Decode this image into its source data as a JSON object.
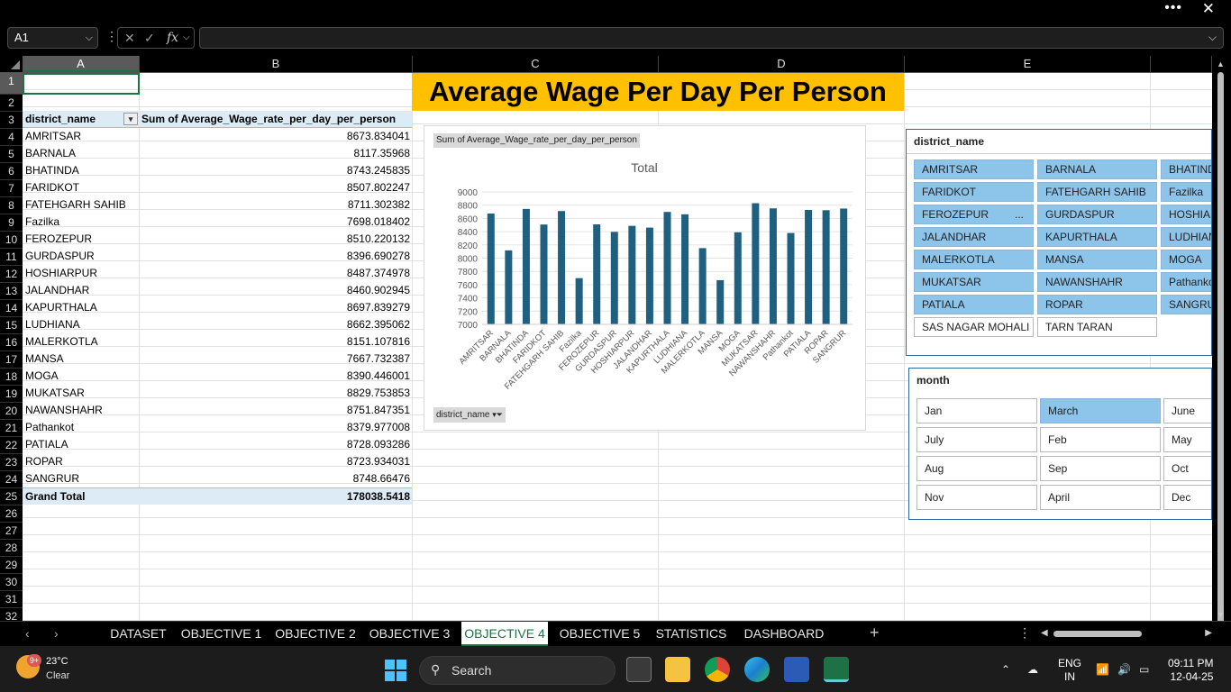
{
  "window": {
    "more_label": "•••",
    "close_label": "✕"
  },
  "formula_bar": {
    "name_box": "A1",
    "cancel_icon": "✕",
    "enter_icon": "✓",
    "fx_label": "fx",
    "formula_value": ""
  },
  "columns": [
    "A",
    "B",
    "C",
    "D",
    "E"
  ],
  "rows": [
    "1",
    "2",
    "3",
    "4",
    "5",
    "6",
    "7",
    "8",
    "9",
    "10",
    "11",
    "12",
    "13",
    "14",
    "15",
    "16",
    "17",
    "18",
    "19",
    "20",
    "21",
    "22",
    "23",
    "24",
    "25",
    "26",
    "27",
    "28",
    "29",
    "30",
    "31",
    "32"
  ],
  "banner_title": "Average Wage Per Day Per Person",
  "pivot": {
    "header_district": "district_name",
    "header_value": "Sum of Average_Wage_rate_per_day_per_person",
    "rows": [
      {
        "name": "AMRITSAR",
        "value": "8673.834041"
      },
      {
        "name": "BARNALA",
        "value": "8117.35968"
      },
      {
        "name": "BHATINDA",
        "value": "8743.245835"
      },
      {
        "name": "FARIDKOT",
        "value": "8507.802247"
      },
      {
        "name": "FATEHGARH SAHIB",
        "value": "8711.302382"
      },
      {
        "name": "Fazilka",
        "value": "7698.018402"
      },
      {
        "name": "FEROZEPUR",
        "value": "8510.220132"
      },
      {
        "name": "GURDASPUR",
        "value": "8396.690278"
      },
      {
        "name": "HOSHIARPUR",
        "value": "8487.374978"
      },
      {
        "name": "JALANDHAR",
        "value": "8460.902945"
      },
      {
        "name": "KAPURTHALA",
        "value": "8697.839279"
      },
      {
        "name": "LUDHIANA",
        "value": "8662.395062"
      },
      {
        "name": "MALERKOTLA",
        "value": "8151.107816"
      },
      {
        "name": "MANSA",
        "value": "7667.732387"
      },
      {
        "name": "MOGA",
        "value": "8390.446001"
      },
      {
        "name": "MUKATSAR",
        "value": "8829.753853"
      },
      {
        "name": "NAWANSHAHR",
        "value": "8751.847351"
      },
      {
        "name": "Pathankot",
        "value": "8379.977008"
      },
      {
        "name": "PATIALA",
        "value": "8728.093286"
      },
      {
        "name": "ROPAR",
        "value": "8723.934031"
      },
      {
        "name": "SANGRUR",
        "value": "8748.66476"
      }
    ],
    "grand_total_label": "Grand Total",
    "grand_total_value": "178038.5418"
  },
  "chart_data": {
    "type": "bar",
    "title": "Total",
    "value_field_button": "Sum of Average_Wage_rate_per_day_per_person",
    "axis_field_button": "district_name",
    "categories": [
      "AMRITSAR",
      "BARNALA",
      "BHATINDA",
      "FARIDKOT",
      "FATEHGARH SAHIB",
      "Fazilka",
      "FEROZEPUR",
      "GURDASPUR",
      "HOSHIARPUR",
      "JALANDHAR",
      "KAPURTHALA",
      "LUDHIANA",
      "MALERKOTLA",
      "MANSA",
      "MOGA",
      "MUKATSAR",
      "NAWANSHAHR",
      "Pathankot",
      "PATIALA",
      "ROPAR",
      "SANGRUR"
    ],
    "values": [
      8673.834041,
      8117.35968,
      8743.245835,
      8507.802247,
      8711.302382,
      7698.018402,
      8510.220132,
      8396.690278,
      8487.374978,
      8460.902945,
      8697.839279,
      8662.395062,
      8151.107816,
      7667.732387,
      8390.446001,
      8829.753853,
      8751.847351,
      8379.977008,
      8728.093286,
      8723.934031,
      8748.66476
    ],
    "ylim": [
      7000,
      9000
    ],
    "yticks": [
      "9000",
      "8800",
      "8600",
      "8400",
      "8200",
      "8000",
      "7800",
      "7600",
      "7400",
      "7200",
      "7000"
    ],
    "grid": true,
    "bar_color": "#1f5f7f"
  },
  "slicer_district": {
    "title": "district_name",
    "items": [
      {
        "label": "AMRITSAR",
        "on": true
      },
      {
        "label": "BARNALA",
        "on": true
      },
      {
        "label": "BHATINDA",
        "on": true
      },
      {
        "label": "FARIDKOT",
        "on": true
      },
      {
        "label": "FATEHGARH SAHIB",
        "on": true
      },
      {
        "label": "Fazilka",
        "on": true
      },
      {
        "label": "FEROZEPUR",
        "on": true,
        "more": "..."
      },
      {
        "label": "GURDASPUR",
        "on": true
      },
      {
        "label": "HOSHIARPUR",
        "on": true
      },
      {
        "label": "JALANDHAR",
        "on": true
      },
      {
        "label": "KAPURTHALA",
        "on": true
      },
      {
        "label": "LUDHIANA",
        "on": true
      },
      {
        "label": "MALERKOTLA",
        "on": true
      },
      {
        "label": "MANSA",
        "on": true
      },
      {
        "label": "MOGA",
        "on": true
      },
      {
        "label": "MUKATSAR",
        "on": true
      },
      {
        "label": "NAWANSHAHR",
        "on": true
      },
      {
        "label": "Pathankot",
        "on": true
      },
      {
        "label": "PATIALA",
        "on": true
      },
      {
        "label": "ROPAR",
        "on": true
      },
      {
        "label": "SANGRUR",
        "on": true
      },
      {
        "label": "SAS NAGAR MOHALI",
        "on": false
      },
      {
        "label": "TARN TARAN",
        "on": false
      }
    ]
  },
  "slicer_month": {
    "title": "month",
    "items": [
      {
        "label": "Jan",
        "on": false
      },
      {
        "label": "March",
        "on": true
      },
      {
        "label": "June",
        "on": false
      },
      {
        "label": "July",
        "on": false
      },
      {
        "label": "Feb",
        "on": false
      },
      {
        "label": "May",
        "on": false
      },
      {
        "label": "Aug",
        "on": false
      },
      {
        "label": "Sep",
        "on": false
      },
      {
        "label": "Oct",
        "on": false
      },
      {
        "label": "Nov",
        "on": false
      },
      {
        "label": "April",
        "on": false
      },
      {
        "label": "Dec",
        "on": false
      }
    ]
  },
  "sheet_tabs": [
    "DATASET",
    "OBJECTIVE 1",
    "OBJECTIVE 2",
    "OBJECTIVE 3",
    "OBJECTIVE 4",
    "OBJECTIVE 5",
    "STATISTICS",
    "DASHBOARD"
  ],
  "active_tab": "OBJECTIVE 4",
  "tab_nav": {
    "prev": "‹",
    "next": "›",
    "add": "+",
    "more": "⋮"
  },
  "taskbar": {
    "weather_badge": "9+",
    "temperature": "23°C",
    "condition": "Clear",
    "search_label": "Search",
    "lang_top": "ENG",
    "lang_bottom": "IN",
    "time": "09:11 PM",
    "date": "12-04-25"
  }
}
